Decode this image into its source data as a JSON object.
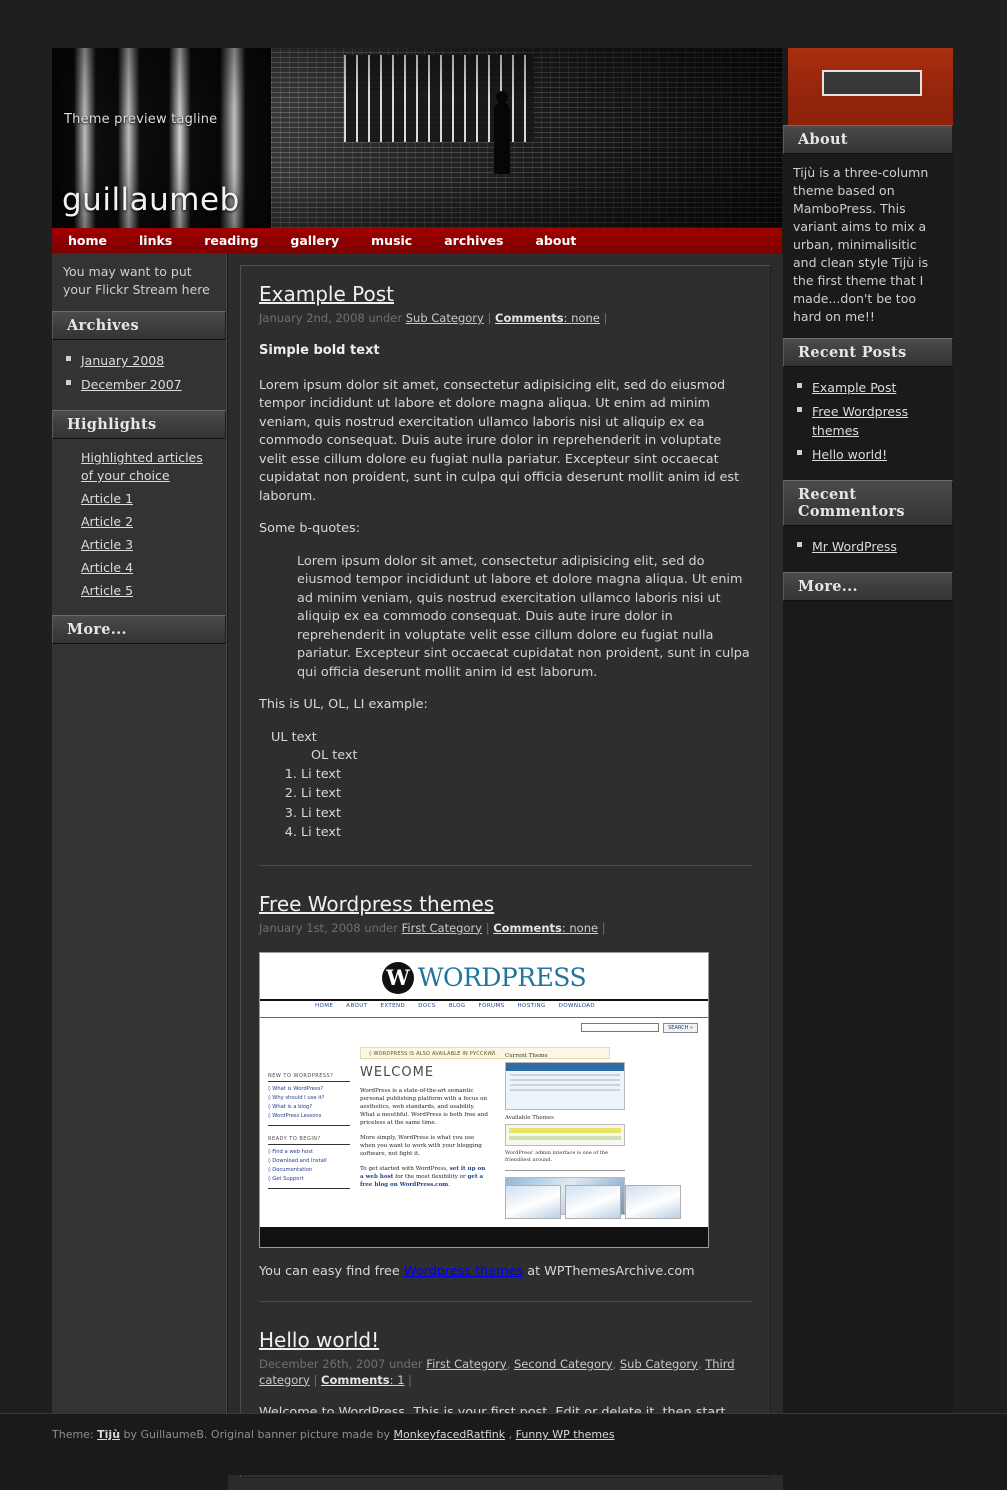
{
  "site": {
    "tagline": "Theme preview tagline",
    "title": "guillaumeb"
  },
  "search": {
    "value": "",
    "placeholder": ""
  },
  "nav": {
    "items": [
      {
        "label": "home"
      },
      {
        "label": "links"
      },
      {
        "label": "reading"
      },
      {
        "label": "gallery"
      },
      {
        "label": "music"
      },
      {
        "label": "archives"
      },
      {
        "label": "about"
      }
    ]
  },
  "left_sidebar": {
    "flickr_note": "You may want to put your Flickr Stream here",
    "archives": {
      "title": "Archives",
      "items": [
        {
          "label": "January 2008"
        },
        {
          "label": "December 2007"
        }
      ]
    },
    "highlights": {
      "title": "Highlights",
      "items": [
        {
          "label": "Highlighted articles of your choice"
        },
        {
          "label": "Article 1"
        },
        {
          "label": "Article 2"
        },
        {
          "label": "Article 3"
        },
        {
          "label": "Article 4"
        },
        {
          "label": "Article 5"
        }
      ]
    },
    "more": {
      "title": "More..."
    }
  },
  "right_sidebar": {
    "about": {
      "title": "About",
      "text": "Tijù is a three-column theme based on MamboPress. This variant aims to mix a urban, minimalisitic and clean style Tijù is the first theme that I made...don't be too hard on me!!"
    },
    "recent_posts": {
      "title": "Recent Posts",
      "items": [
        {
          "label": "Example Post"
        },
        {
          "label": "Free Wordpress themes"
        },
        {
          "label": "Hello world!"
        }
      ]
    },
    "recent_commentors": {
      "title": "Recent Commentors",
      "items": [
        {
          "label": "Mr WordPress"
        }
      ]
    },
    "more": {
      "title": "More..."
    }
  },
  "posts": {
    "post1": {
      "title": "Example Post",
      "date": "January 2nd, 2008 under",
      "category": "Sub Category",
      "sep_open": "|",
      "comments_label": "Comments",
      "comments_value": "none",
      "sep_close": "|",
      "bold_lead": "Simple bold text",
      "paragraph": "Lorem ipsum dolor sit amet, consectetur adipisicing elit, sed do eiusmod tempor incididunt ut labore et dolore magna aliqua. Ut enim ad minim veniam, quis nostrud exercitation ullamco laboris nisi ut aliquip ex ea commodo consequat. Duis aute irure dolor in reprehenderit in voluptate velit esse cillum dolore eu fugiat nulla pariatur. Excepteur sint occaecat cupidatat non proident, sunt in culpa qui officia deserunt mollit anim id est laborum.",
      "bquote_intro": "Some b-quotes:",
      "blockquote": "Lorem ipsum dolor sit amet, consectetur adipisicing elit, sed do eiusmod tempor incididunt ut labore et dolore magna aliqua. Ut enim ad minim veniam, quis nostrud exercitation ullamco laboris nisi ut aliquip ex ea commodo consequat. Duis aute irure dolor in reprehenderit in voluptate velit esse cillum dolore eu fugiat nulla pariatur. Excepteur sint occaecat cupidatat non proident, sunt in culpa qui officia deserunt mollit anim id est laborum.",
      "list_intro": "This is UL, OL, LI example:",
      "ul_text": "UL text",
      "ol_text": "OL text",
      "li_items": [
        {
          "label": "Li text"
        },
        {
          "label": "Li text"
        },
        {
          "label": "Li text"
        },
        {
          "label": "Li text"
        }
      ]
    },
    "post2": {
      "title": "Free Wordpress themes",
      "date": "January 1st, 2008 under",
      "category": "First Category",
      "sep_open": "|",
      "comments_label": "Comments",
      "comments_value": "none",
      "sep_close": "|",
      "caption_pre": "You can easy find free ",
      "caption_link": "Wordpress themes",
      "caption_post": " at WPThemesArchive.com"
    },
    "post3": {
      "title": "Hello world!",
      "date": "December 26th, 2007 under",
      "categories": [
        {
          "label": "First Category"
        },
        {
          "label": "Second Category"
        },
        {
          "label": "Sub Category"
        },
        {
          "label": "Third category"
        }
      ],
      "sep_open": "|",
      "comments_label": "Comments",
      "comments_value": "1",
      "sep_close": "|",
      "body": "Welcome to WordPress. This is your first post. Edit or delete it, then start blogging!"
    }
  },
  "wp_screenshot": {
    "brand_mark": "W",
    "brand_word": "WORDPRESS",
    "nav": [
      {
        "label": "HOME"
      },
      {
        "label": "ABOUT"
      },
      {
        "label": "EXTEND"
      },
      {
        "label": "DOCS"
      },
      {
        "label": "BLOG"
      },
      {
        "label": "FORUMS"
      },
      {
        "label": "HOSTING"
      },
      {
        "label": "DOWNLOAD"
      }
    ],
    "search_button": "SEARCH »",
    "notice": "◊ WORDPRESS IS ALSO AVAILABLE IN РУССКИЙ.",
    "welcome_heading": "WELCOME",
    "para1": "WordPress is a state-of-the-art semantic personal publishing platform with a focus on aesthetics, web standards, and usability. What a mouthful. WordPress is both free and priceless at the same time.",
    "para2": "More simply, WordPress is what you use when you want to work with your blogging software, not fight it.",
    "para3_pre": "To get started with WordPress, ",
    "para3_link1": "set it up on a web host",
    "para3_mid": " for the most flexibility or ",
    "para3_link2": "get a free blog on WordPress.com",
    "para3_end": ".",
    "left_block1_title": "NEW TO WORDPRESS?",
    "left_block1_links": [
      {
        "label": "◊ What is WordPress?"
      },
      {
        "label": "◊ Why should I use it?"
      },
      {
        "label": "◊ What is a blog?"
      },
      {
        "label": "◊ WordPress Lessons"
      }
    ],
    "left_block2_title": "READY TO BEGIN?",
    "left_block2_links": [
      {
        "label": "◊ Find a web host"
      },
      {
        "label": "◊ Download and Install"
      },
      {
        "label": "◊ Documentation"
      },
      {
        "label": "◊ Get Support"
      }
    ],
    "right_cap1": "Current Theme",
    "right_cap2": "Available Themes",
    "right_caption": "WordPress' admin interface is one of the friendliest around."
  },
  "footer": {
    "pre": "Theme: ",
    "theme_link": "Tijù",
    "mid": " by GuillaumeB. Original banner picture made by ",
    "credit_link": "MonkeyfacedRatfink",
    "sep": " , ",
    "last_link": "Funny WP themes"
  },
  "colors": {
    "nav_red": "#8e0000",
    "brand_red": "#a9300f",
    "page_bg": "#1a1a1a",
    "sidebar_bg": "#333333",
    "content_bg": "#2e2e2e",
    "link": "#dcdcdc"
  }
}
